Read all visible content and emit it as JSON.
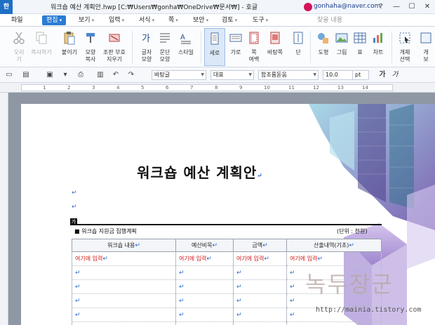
{
  "window": {
    "app_glyph": "한",
    "title": "워크숍 예산 계획안.hwp [C:₩Users₩gonha₩OneDrive₩문서₩] - 호글",
    "user_email": "gonhaha@naver.com",
    "controls": [
      "?",
      "—",
      "☐",
      "✕"
    ]
  },
  "menu": {
    "file": "파일",
    "edit": "편집",
    "view": "보기",
    "insert": "입력",
    "format": "서식",
    "page": "쪽",
    "security": "보안",
    "review": "검토",
    "tools": "도구",
    "search_placeholder": "찾을 내용"
  },
  "ribbon": [
    {
      "id": "cut",
      "label": "오리\n기",
      "icon": "scissors-icon",
      "disabled": true
    },
    {
      "id": "copy",
      "label": "복사하기",
      "icon": "copy-icon",
      "disabled": true
    },
    {
      "id": "paste",
      "label": "붙이기",
      "icon": "paste-icon",
      "disabled": false
    },
    {
      "id": "shape-copy",
      "label": "모양\n복사",
      "icon": "brush-icon",
      "disabled": false
    },
    {
      "id": "remove-symbol",
      "label": "조판 부호\n지우기",
      "icon": "eraser-icon",
      "disabled": false
    },
    {
      "id": "char-shape",
      "label": "글자\n모양",
      "icon": "char-shape-icon",
      "disabled": false
    },
    {
      "id": "para-shape",
      "label": "문단\n모양",
      "icon": "para-shape-icon",
      "disabled": false
    },
    {
      "id": "style",
      "label": "스타일",
      "icon": "style-icon",
      "disabled": false
    },
    {
      "id": "portrait",
      "label": "세로",
      "icon": "portrait-page-icon",
      "disabled": false,
      "selected": true
    },
    {
      "id": "landscape",
      "label": "가로",
      "icon": "landscape-page-icon",
      "disabled": false
    },
    {
      "id": "margins",
      "label": "쪽\n여백",
      "icon": "margins-icon",
      "disabled": false
    },
    {
      "id": "background",
      "label": "바탕쪽",
      "icon": "background-page-icon",
      "disabled": false
    },
    {
      "id": "columns",
      "label": "단",
      "icon": "columns-icon",
      "disabled": false
    },
    {
      "id": "shapes",
      "label": "도형",
      "icon": "shapes-icon",
      "disabled": false
    },
    {
      "id": "picture",
      "label": "그림",
      "icon": "picture-icon",
      "disabled": false
    },
    {
      "id": "table",
      "label": "표",
      "icon": "table-icon",
      "disabled": false
    },
    {
      "id": "chart",
      "label": "차트",
      "icon": "chart-icon",
      "disabled": false
    },
    {
      "id": "select-object",
      "label": "개체\n선택",
      "icon": "select-object-icon",
      "disabled": false
    },
    {
      "id": "view",
      "label": "개\n보",
      "icon": "view-icon",
      "disabled": false
    }
  ],
  "format_bar": {
    "style_name": "바탕글",
    "language": "대표",
    "font": "함초롬돋움",
    "size": "10.0",
    "unit": "pt",
    "bold_glyph": "가",
    "italic_glyph": "가"
  },
  "ruler": {
    "numbers": [
      "1",
      "2",
      "3",
      "4",
      "5",
      "6",
      "7",
      "8",
      "9",
      "10",
      "11",
      "12",
      "13",
      "14"
    ]
  },
  "document": {
    "title": "워크숍 예산 계획안",
    "para_mark": "↵",
    "cursor_tag": "가",
    "subheading": "■ 워크숍 지원금 집행계획",
    "unit": "(단위 : 천원)",
    "table": {
      "headers": [
        "워크숍 내용",
        "예산비목",
        "금액",
        "산출내역(기초)"
      ],
      "first_row": [
        "여기에 입력",
        "여기에 입력",
        "여기에 입력",
        "여기에 입력"
      ],
      "empty_rows": 5
    }
  },
  "watermark": {
    "text": "녹두장군",
    "url": "http://mainia.tistory.com"
  },
  "colors": {
    "accent": "#2a7bd4",
    "placeholder_red": "#d21a1a",
    "para_mark_blue": "#2a6ad0"
  }
}
